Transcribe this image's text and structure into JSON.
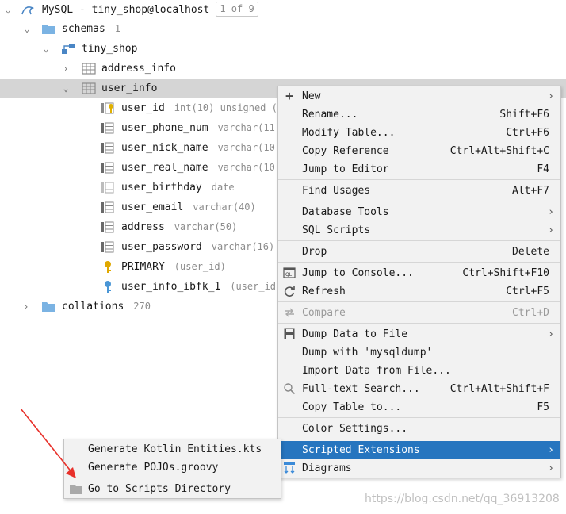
{
  "tree": {
    "root": {
      "label": "MySQL - tiny_shop@localhost",
      "badge": "1 of 9"
    },
    "schemas": {
      "label": "schemas",
      "count": "1"
    },
    "db": {
      "label": "tiny_shop"
    },
    "tables": [
      {
        "label": "address_info"
      },
      {
        "label": "user_info"
      }
    ],
    "columns": [
      {
        "name": "user_id",
        "type": "int(10) unsigned ("
      },
      {
        "name": "user_phone_num",
        "type": "varchar(11"
      },
      {
        "name": "user_nick_name",
        "type": "varchar(10"
      },
      {
        "name": "user_real_name",
        "type": "varchar(10"
      },
      {
        "name": "user_birthday",
        "type": "date"
      },
      {
        "name": "user_email",
        "type": "varchar(40)"
      },
      {
        "name": "address",
        "type": "varchar(50)"
      },
      {
        "name": "user_password",
        "type": "varchar(16)"
      }
    ],
    "keys": [
      {
        "name": "PRIMARY",
        "hint": "(user_id)"
      },
      {
        "name": "user_info_ibfk_1",
        "hint": "(user_id"
      }
    ],
    "collations": {
      "label": "collations",
      "count": "270"
    }
  },
  "menu": {
    "items": [
      {
        "label": "New",
        "shortcut": ""
      },
      {
        "label": "Rename...",
        "shortcut": "Shift+F6"
      },
      {
        "label": "Modify Table...",
        "shortcut": "Ctrl+F6"
      },
      {
        "label": "Copy Reference",
        "shortcut": "Ctrl+Alt+Shift+C"
      },
      {
        "label": "Jump to Editor",
        "shortcut": "F4"
      },
      {
        "label": "Find Usages",
        "shortcut": "Alt+F7"
      },
      {
        "label": "Database Tools",
        "shortcut": ""
      },
      {
        "label": "SQL Scripts",
        "shortcut": ""
      },
      {
        "label": "Drop",
        "shortcut": "Delete"
      },
      {
        "label": "Jump to Console...",
        "shortcut": "Ctrl+Shift+F10"
      },
      {
        "label": "Refresh",
        "shortcut": "Ctrl+F5"
      },
      {
        "label": "Compare",
        "shortcut": "Ctrl+D"
      },
      {
        "label": "Dump Data to File",
        "shortcut": ""
      },
      {
        "label": "Dump with 'mysqldump'",
        "shortcut": ""
      },
      {
        "label": "Import Data from File...",
        "shortcut": ""
      },
      {
        "label": "Full-text Search...",
        "shortcut": "Ctrl+Alt+Shift+F"
      },
      {
        "label": "Copy Table to...",
        "shortcut": "F5"
      },
      {
        "label": "Color Settings...",
        "shortcut": ""
      },
      {
        "label": "Scripted Extensions",
        "shortcut": ""
      },
      {
        "label": "Diagrams",
        "shortcut": ""
      }
    ],
    "submenu_glyph": "›"
  },
  "submenu": {
    "items": [
      {
        "label": "Generate Kotlin Entities.kts"
      },
      {
        "label": "Generate POJOs.groovy"
      },
      {
        "label": "Go to Scripts Directory"
      }
    ]
  },
  "watermark": "https://blog.csdn.net/qq_36913208",
  "colors": {
    "selection": "#2675bf",
    "tree_selection": "#d5d5d5",
    "arrow": "#e8302a"
  }
}
